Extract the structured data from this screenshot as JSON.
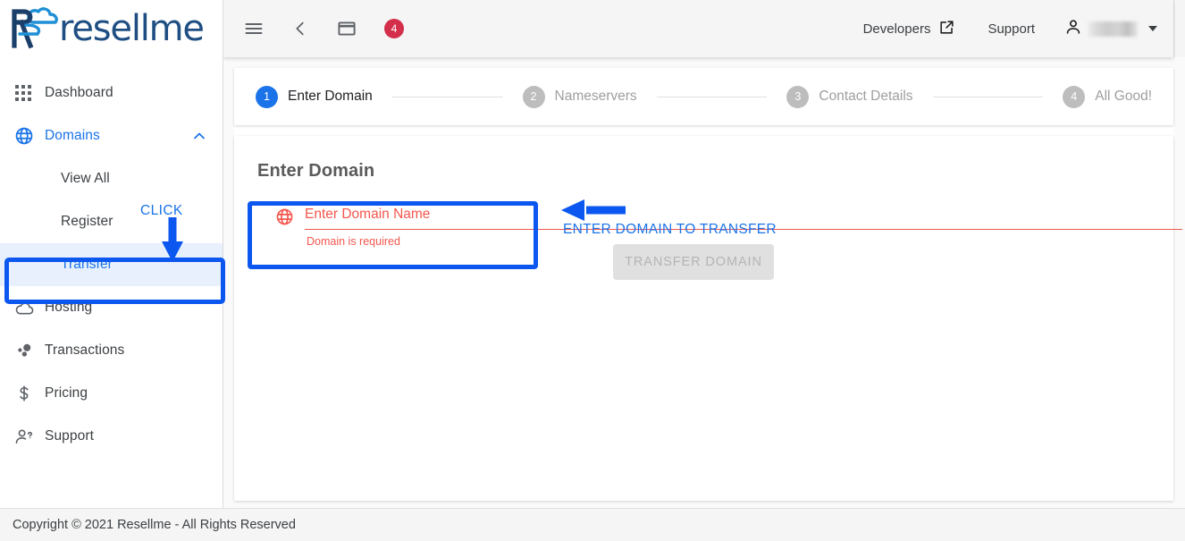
{
  "brand": {
    "name": "resellme",
    "logo_icon": "resellme-cloud-r-logo"
  },
  "topbar": {
    "menu_icon": "hamburger-menu-icon",
    "back_icon": "chevron-left-icon",
    "window_icon": "window-icon",
    "notification_count": "4",
    "developers_label": "Developers",
    "developers_icon": "external-link-icon",
    "support_label": "Support",
    "account_icon": "person-icon",
    "account_name": "",
    "dropdown_icon": "caret-down-icon"
  },
  "sidebar": {
    "items": [
      {
        "label": "Dashboard",
        "icon": "apps-grid-icon"
      },
      {
        "label": "Domains",
        "icon": "globe-icon",
        "chevron": "chevron-up-icon"
      },
      {
        "label": "Hosting",
        "icon": "cloud-icon"
      },
      {
        "label": "Transactions",
        "icon": "bubbles-icon"
      },
      {
        "label": "Pricing",
        "icon": "dollar-icon"
      },
      {
        "label": "Support",
        "icon": "person-question-icon"
      }
    ],
    "sub_items": [
      {
        "label": "View All"
      },
      {
        "label": "Register"
      },
      {
        "label": "Transfer"
      }
    ]
  },
  "stepper": {
    "steps": [
      {
        "num": "1",
        "label": "Enter Domain"
      },
      {
        "num": "2",
        "label": "Nameservers"
      },
      {
        "num": "3",
        "label": "Contact Details"
      },
      {
        "num": "4",
        "label": "All Good!"
      }
    ]
  },
  "panel": {
    "title": "Enter Domain",
    "field_icon": "globe-icon",
    "field_placeholder": "Enter Domain Name",
    "field_value": "",
    "field_error": "Domain is required",
    "submit_label": "TRANSFER DOMAIN"
  },
  "annotations": {
    "click_label": "CLICK",
    "enter_domain_label": "ENTER DOMAIN TO TRANSFER",
    "accent_color": "#0b57f0"
  },
  "footer": {
    "copyright": "Copyright © 2021 Resellme - All Rights Reserved"
  }
}
